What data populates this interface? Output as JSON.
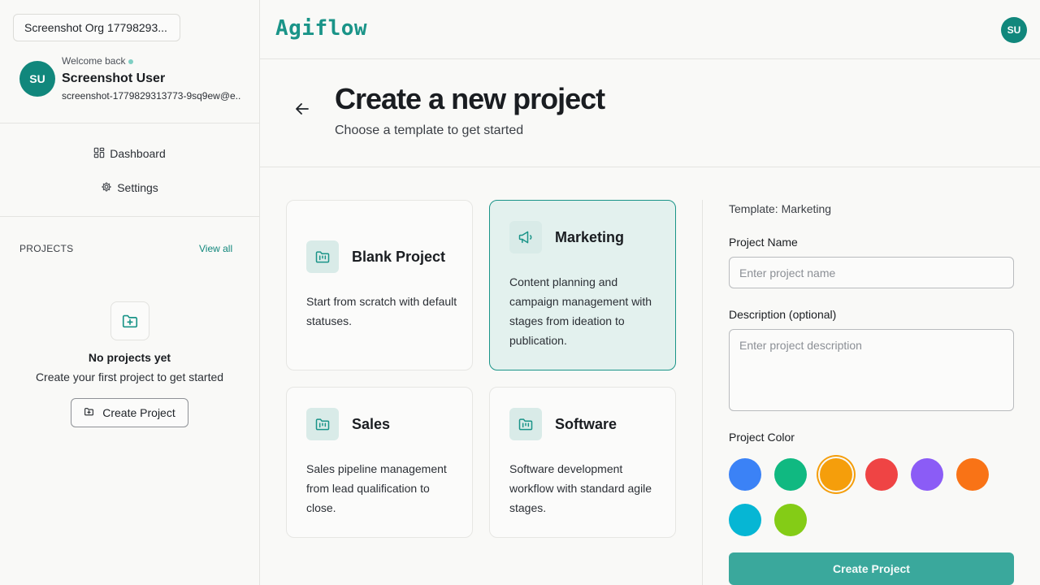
{
  "sidebar": {
    "org_name": "Screenshot Org 17798293...",
    "user": {
      "initials": "SU",
      "welcome": "Welcome back",
      "name": "Screenshot User",
      "email": "screenshot-1779829313773-9sq9ew@e..."
    },
    "nav": [
      {
        "label": "Dashboard",
        "icon": "dashboard-grid-icon"
      },
      {
        "label": "Settings",
        "icon": "gear-icon"
      }
    ],
    "projects_header": "PROJECTS",
    "view_all": "View all",
    "empty": {
      "icon": "folder-plus-icon",
      "title": "No projects yet",
      "subtitle": "Create your first project to get started",
      "button": "Create Project"
    }
  },
  "topbar": {
    "logo": "Agiflow",
    "avatar_initials": "SU"
  },
  "header": {
    "title": "Create a new project",
    "subtitle": "Choose a template to get started"
  },
  "templates": [
    {
      "name": "Blank Project",
      "description": "Start from scratch with default statuses.",
      "icon": "folder-kanban-icon",
      "selected": false
    },
    {
      "name": "Marketing",
      "description": "Content planning and campaign management with stages from ideation to publication.",
      "icon": "megaphone-icon",
      "selected": true
    },
    {
      "name": "Sales",
      "description": "Sales pipeline management from lead qualification to close.",
      "icon": "folder-kanban-icon",
      "selected": false
    },
    {
      "name": "Software",
      "description": "Software development workflow with standard agile stages.",
      "icon": "folder-kanban-icon",
      "selected": false
    }
  ],
  "form": {
    "template_label": "Template: Marketing",
    "name_label": "Project Name",
    "name_placeholder": "Enter project name",
    "name_value": "",
    "description_label": "Description (optional)",
    "description_placeholder": "Enter project description",
    "color_label": "Project Color",
    "colors": [
      "#3b82f6",
      "#10b981",
      "#f59e0b",
      "#ef4444",
      "#8b5cf6",
      "#f97316",
      "#06b6d4",
      "#84cc16"
    ],
    "selected_color": "#f59e0b",
    "submit": "Create Project"
  },
  "colors": {
    "accent": "#11877c",
    "selected_card_bg": "#e3f1ee",
    "submit_bg": "#3aa89c"
  }
}
